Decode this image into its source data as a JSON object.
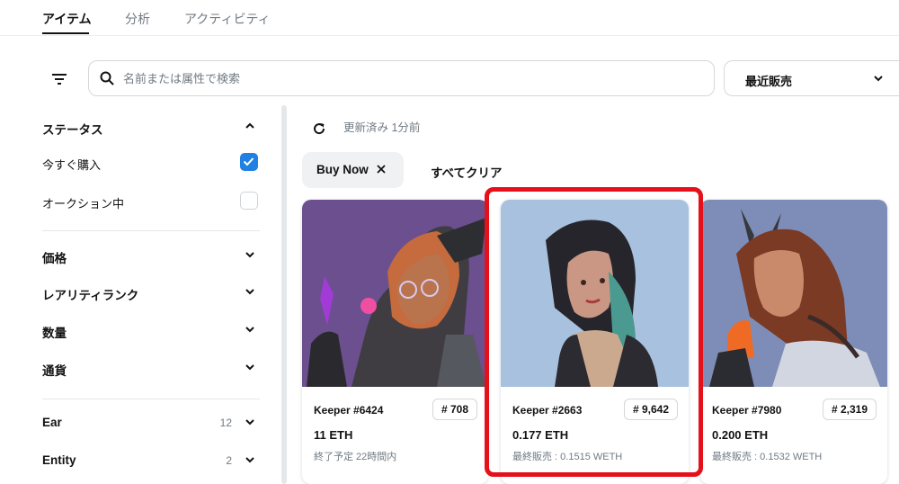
{
  "tabs": [
    {
      "label": "アイテム",
      "active": true
    },
    {
      "label": "分析",
      "active": false
    },
    {
      "label": "アクティビティ",
      "active": false
    }
  ],
  "search": {
    "placeholder": "名前または属性で検索",
    "value": ""
  },
  "sort": {
    "selected": "最近販売"
  },
  "sidebar": {
    "status": {
      "title": "ステータス",
      "options": [
        {
          "label": "今すぐ購入",
          "checked": true
        },
        {
          "label": "オークション中",
          "checked": false
        }
      ]
    },
    "filters": [
      {
        "label": "価格"
      },
      {
        "label": "レアリティランク"
      },
      {
        "label": "数量"
      },
      {
        "label": "通貨"
      }
    ],
    "traits": [
      {
        "label": "Ear",
        "count": "12"
      },
      {
        "label": "Entity",
        "count": "2"
      }
    ]
  },
  "main": {
    "updated": "更新済み 1分前",
    "active_filter": "Buy Now",
    "clear_all": "すべてクリア"
  },
  "cards": [
    {
      "name": "Keeper #6424",
      "rank": "# 708",
      "price": "11 ETH",
      "sub": "終了予定 22時間内",
      "bg": "#6b4f8f"
    },
    {
      "name": "Keeper #2663",
      "rank": "# 9,642",
      "price": "0.177 ETH",
      "sub": "最終販売 : 0.1515 WETH",
      "bg": "#a7c1de"
    },
    {
      "name": "Keeper #7980",
      "rank": "# 2,319",
      "price": "0.200 ETH",
      "sub": "最終販売 : 0.1532 WETH",
      "bg": "#7e8db7"
    }
  ],
  "colors": {
    "accent": "#2081e2",
    "highlight": "#e4111b"
  }
}
